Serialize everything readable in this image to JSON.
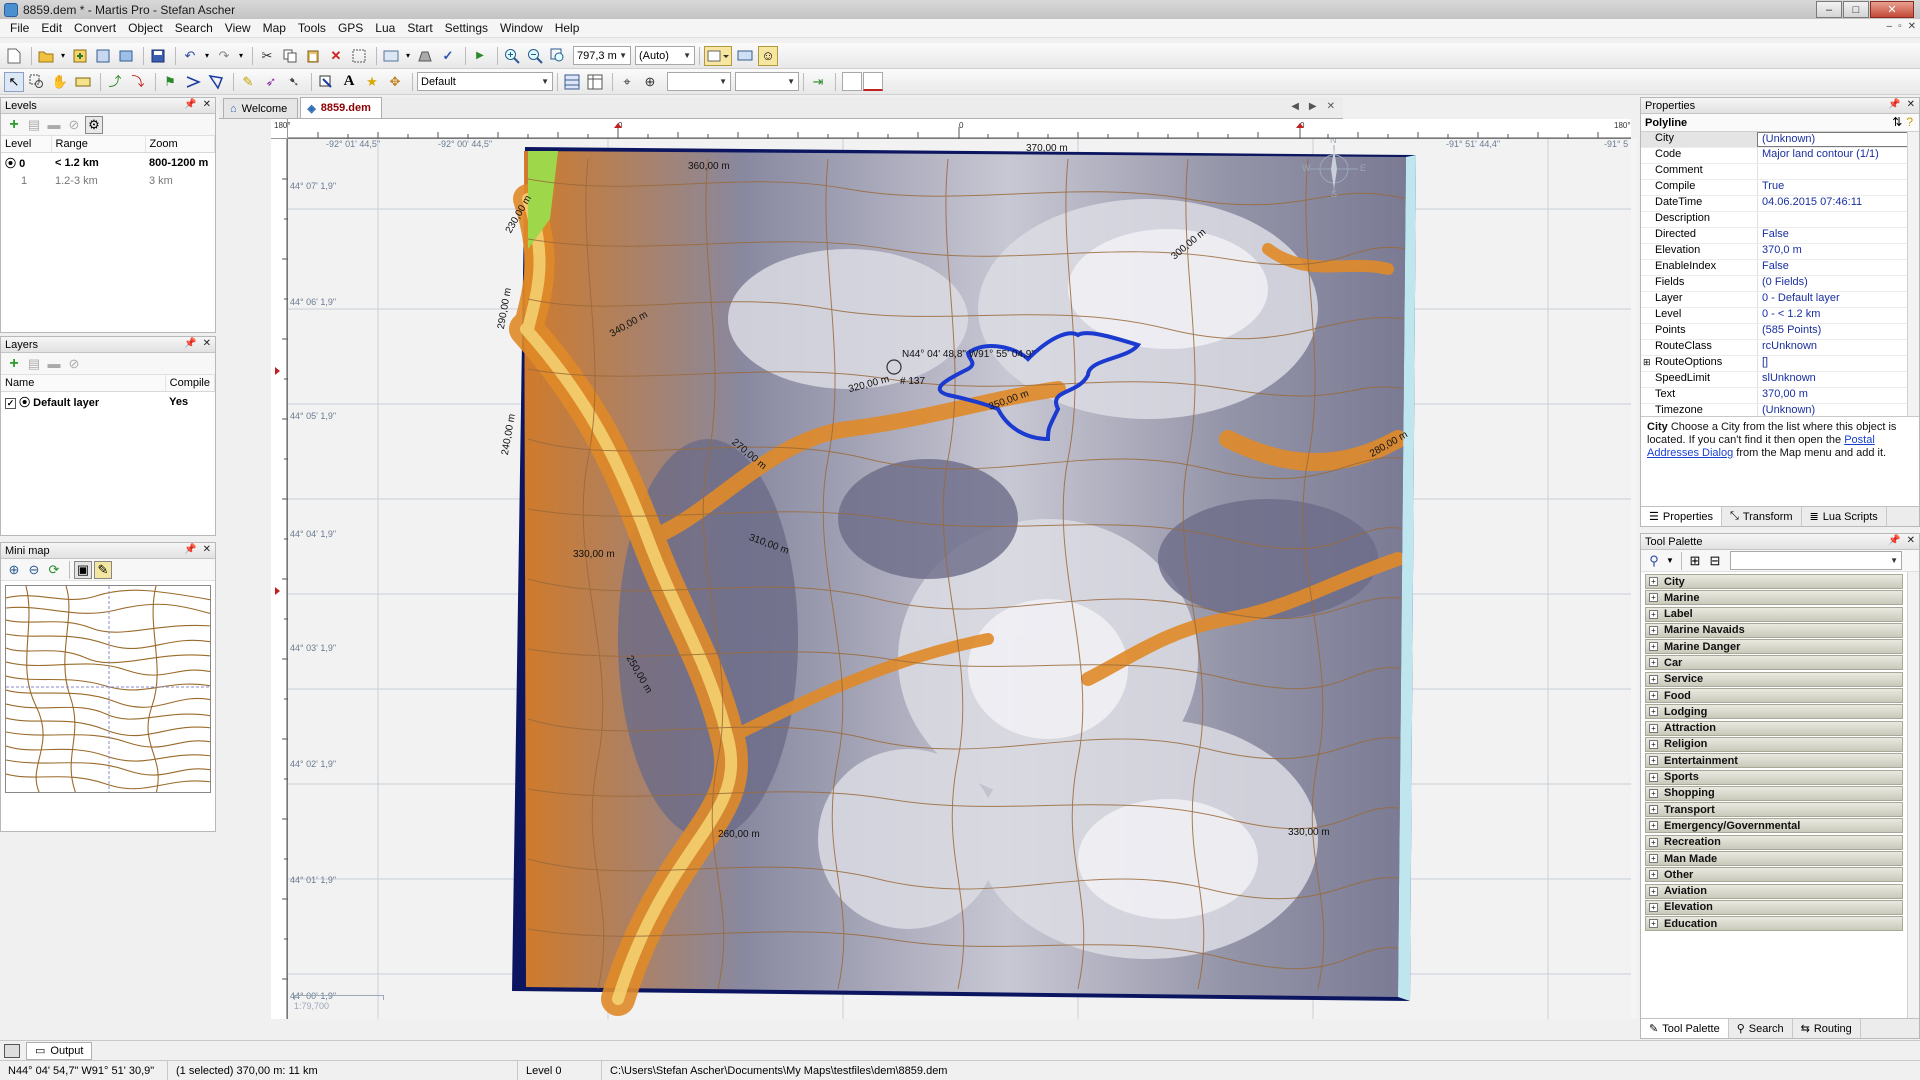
{
  "window": {
    "title": "8859.dem * - Martis Pro - Stefan Ascher",
    "min_label": "–",
    "max_label": "□",
    "close_label": "✕"
  },
  "menu": [
    "File",
    "Edit",
    "Convert",
    "Object",
    "Search",
    "View",
    "Map",
    "Tools",
    "GPS",
    "Lua",
    "Start",
    "Settings",
    "Window",
    "Help"
  ],
  "mdi_controls": {
    "min_label": "–",
    "restore_label": "▫",
    "close_label": "✕"
  },
  "toolbar": {
    "scale_value": "797,3 m",
    "zoom_mode": "(Auto)",
    "style_value": "Default"
  },
  "levels": {
    "title": "Levels",
    "columns": [
      "Level",
      "Range",
      "Zoom"
    ],
    "rows": [
      {
        "level": "0",
        "range": "< 1.2 km",
        "zoom": "800-1200 m",
        "active": true
      },
      {
        "level": "1",
        "range": "1.2-3 km",
        "zoom": "3 km",
        "active": false
      }
    ]
  },
  "layers": {
    "title": "Layers",
    "columns": [
      "Name",
      "Compile"
    ],
    "rows": [
      {
        "name": "Default layer",
        "compile": "Yes",
        "checked": true
      }
    ]
  },
  "minimap": {
    "title": "Mini map"
  },
  "tabs": [
    {
      "label": "Welcome",
      "active": false
    },
    {
      "label": "8859.dem",
      "active": true
    }
  ],
  "ruler": {
    "h_left": "180°",
    "h_marks": [
      "0",
      "0",
      "0"
    ],
    "h_right": "180°"
  },
  "map": {
    "lon_labels": [
      "-92° 01' 44,5\"",
      "-92° 00' 44,5\"",
      "-91° 51' 44,4\"",
      "-91° 5"
    ],
    "lat_labels": [
      "44° 07' 1,9\"",
      "44° 06' 1,9\"",
      "44° 05' 1,9\"",
      "44° 04' 1,9\"",
      "44° 03' 1,9\"",
      "44° 02' 1,9\"",
      "44° 01' 1,9\"",
      "44° 00' 1,9\""
    ],
    "contour_labels": [
      "360,00 m",
      "370,00 m",
      "350,00 m",
      "340,00 m",
      "330,00 m",
      "320,00 m",
      "310,00 m",
      "300,00 m",
      "290,00 m",
      "280,00 m",
      "270,00 m",
      "260,00 m",
      "250,00 m",
      "240,00 m",
      "230,00 m",
      "330,00 m"
    ],
    "selected_label": "N44° 04' 48,8\" W91° 55' 04,9\"",
    "selected_point": "# 137",
    "scale_bar": "1:79,700",
    "compass": {
      "n": "N",
      "s": "S",
      "e": "E",
      "w": "W"
    }
  },
  "output": {
    "label": "Output"
  },
  "status": {
    "coords": "N44° 04' 54,7\" W91° 51' 30,9\"",
    "selection": "(1 selected) 370,00 m: 11 km",
    "level": "Level 0",
    "path": "C:\\Users\\Stefan Ascher\\Documents\\My Maps\\testfiles\\dem\\8859.dem"
  },
  "properties": {
    "title": "Properties",
    "object_type": "Polyline",
    "rows": [
      {
        "key": "City",
        "value": "(Unknown)",
        "dropdown": true
      },
      {
        "key": "Code",
        "value": "Major land contour (1/1)"
      },
      {
        "key": "Comment",
        "value": ""
      },
      {
        "key": "Compile",
        "value": "True"
      },
      {
        "key": "DateTime",
        "value": "04.06.2015 07:46:11"
      },
      {
        "key": "Description",
        "value": ""
      },
      {
        "key": "Directed",
        "value": "False"
      },
      {
        "key": "Elevation",
        "value": "370,0 m"
      },
      {
        "key": "EnableIndex",
        "value": "False"
      },
      {
        "key": "Fields",
        "value": "(0 Fields)"
      },
      {
        "key": "Layer",
        "value": "0 - Default layer"
      },
      {
        "key": "Level",
        "value": "0 - < 1.2 km"
      },
      {
        "key": "Points",
        "value": "(585 Points)"
      },
      {
        "key": "RouteClass",
        "value": "rcUnknown"
      },
      {
        "key": "RouteOptions",
        "value": "[]",
        "expandable": true
      },
      {
        "key": "SpeedLimit",
        "value": "slUnknown"
      },
      {
        "key": "Text",
        "value": "370,00 m"
      },
      {
        "key": "Timezone",
        "value": "(Unknown)"
      }
    ],
    "help_key": "City",
    "help_text": "Choose a City from the list where this object is located. If you can't find it then open the",
    "help_link": "Postal Addresses Dialog",
    "help_tail": "from the Map menu and add it.",
    "tabs": [
      "Properties",
      "Transform",
      "Lua Scripts"
    ]
  },
  "palette": {
    "title": "Tool Palette",
    "items": [
      "City",
      "Marine",
      "Label",
      "Marine Navaids",
      "Marine Danger",
      "Car",
      "Service",
      "Food",
      "Lodging",
      "Attraction",
      "Religion",
      "Entertainment",
      "Sports",
      "Shopping",
      "Transport",
      "Emergency/Governmental",
      "Recreation",
      "Man Made",
      "Other",
      "Aviation",
      "Elevation",
      "Education"
    ],
    "tabs": [
      "Tool Palette",
      "Search",
      "Routing"
    ]
  }
}
